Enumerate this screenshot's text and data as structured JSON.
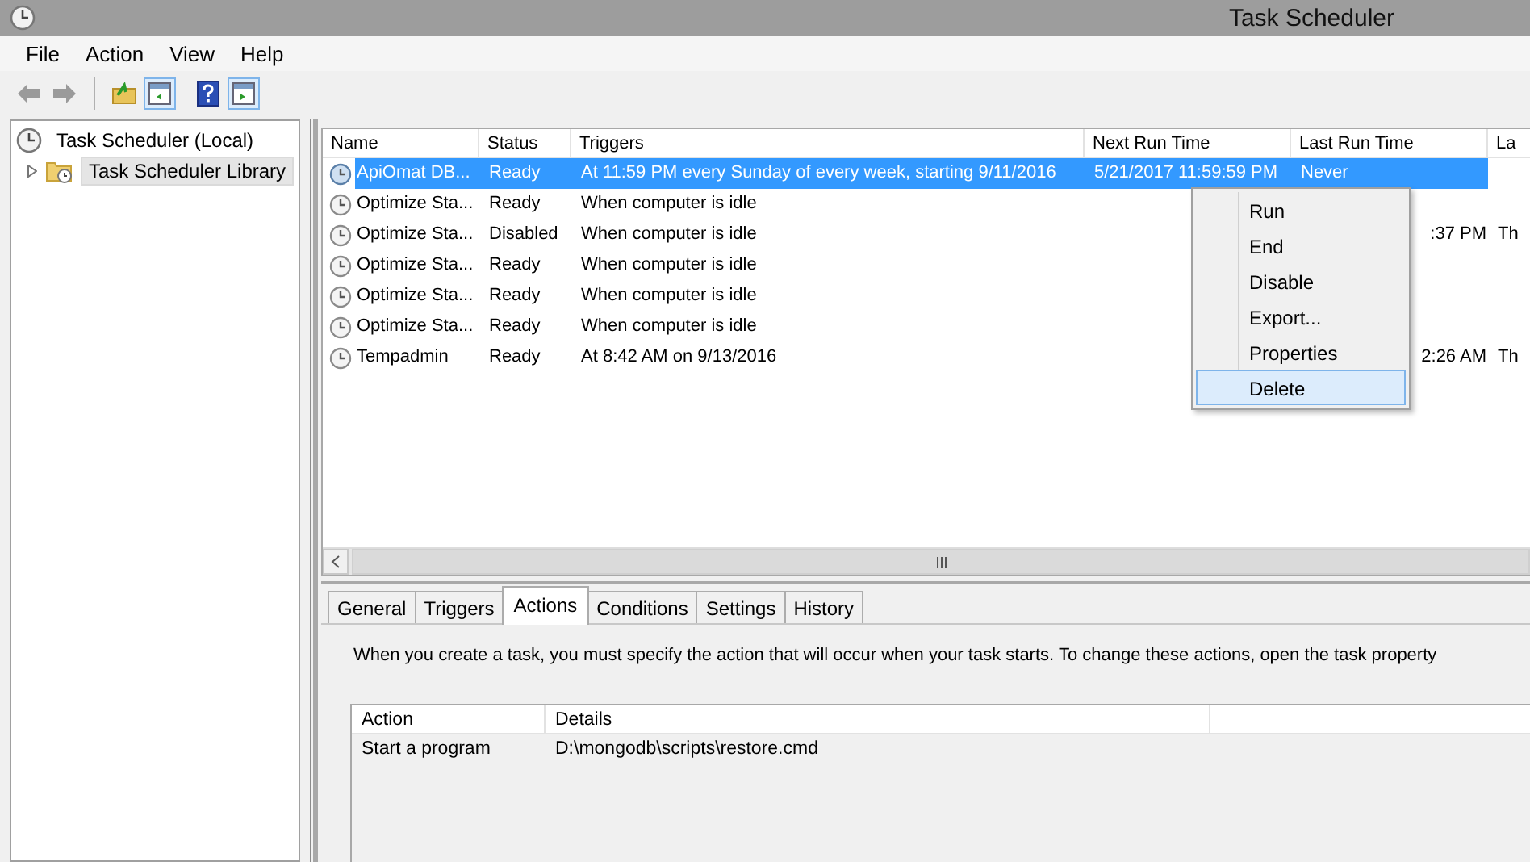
{
  "window": {
    "title": "Task Scheduler"
  },
  "menu_bar": [
    "File",
    "Action",
    "View",
    "Help"
  ],
  "toolbar": [
    {
      "kind": "back",
      "pressed": false
    },
    {
      "kind": "forward",
      "pressed": false
    },
    {
      "kind": "separator"
    },
    {
      "kind": "up",
      "pressed": false
    },
    {
      "kind": "tree_pane",
      "pressed": true
    },
    {
      "kind": "help",
      "pressed": false
    },
    {
      "kind": "action_pane",
      "pressed": true
    }
  ],
  "tree": [
    {
      "label": "Task Scheduler (Local)",
      "selected": false,
      "children": [
        {
          "label": "Task Scheduler Library",
          "selected": true,
          "expanded": false
        }
      ]
    }
  ],
  "tasks": {
    "columns": [
      "Name",
      "Status",
      "Triggers",
      "Next Run Time",
      "Last Run Time",
      "La"
    ],
    "rows": [
      {
        "selected": true,
        "name": "ApiOmat DB...",
        "status": "Ready",
        "triggers": "At 11:59 PM every Sunday of every week, starting 9/11/2016",
        "next_run_time": "5/21/2017 11:59:59 PM",
        "last_run_time": "Never"
      },
      {
        "selected": false,
        "name": "Optimize Sta...",
        "status": "Ready",
        "triggers": "When computer is idle"
      },
      {
        "selected": false,
        "name": "Optimize Sta...",
        "status": "Disabled",
        "triggers": "When computer is idle",
        "last_run_time": ":37 PM",
        "column_6": "Th"
      },
      {
        "selected": false,
        "name": "Optimize Sta...",
        "status": "Ready",
        "triggers": "When computer is idle"
      },
      {
        "selected": false,
        "name": "Optimize Sta...",
        "status": "Ready",
        "triggers": "When computer is idle"
      },
      {
        "selected": false,
        "name": "Optimize Sta...",
        "status": "Ready",
        "triggers": "When computer is idle"
      },
      {
        "selected": false,
        "name": "Tempadmin",
        "status": "Ready",
        "triggers": "At 8:42 AM on 9/13/2016",
        "last_run_time": "2:26 AM",
        "column_6": "Th"
      }
    ]
  },
  "context_menu": {
    "items": [
      {
        "label": "Run",
        "selected": false
      },
      {
        "label": "End",
        "selected": false
      },
      {
        "label": "Disable",
        "selected": false
      },
      {
        "label": "Export...",
        "selected": false
      },
      {
        "label": "Properties",
        "selected": false
      },
      {
        "label": "Delete",
        "selected": true
      }
    ]
  },
  "tabs": [
    {
      "label": "General",
      "selected": false
    },
    {
      "label": "Triggers",
      "selected": false
    },
    {
      "label": "Actions",
      "selected": true
    },
    {
      "label": "Conditions",
      "selected": false
    },
    {
      "label": "Settings",
      "selected": false
    },
    {
      "label": "History",
      "selected": false
    }
  ],
  "actions_panel": {
    "description": "When you create a task, you must specify the action that will occur when your task starts.  To change these actions, open the task property",
    "columns": [
      "Action",
      "Details"
    ],
    "rows": [
      {
        "action": "Start a program",
        "details": "D:\\mongodb\\scripts\\restore.cmd"
      }
    ]
  }
}
